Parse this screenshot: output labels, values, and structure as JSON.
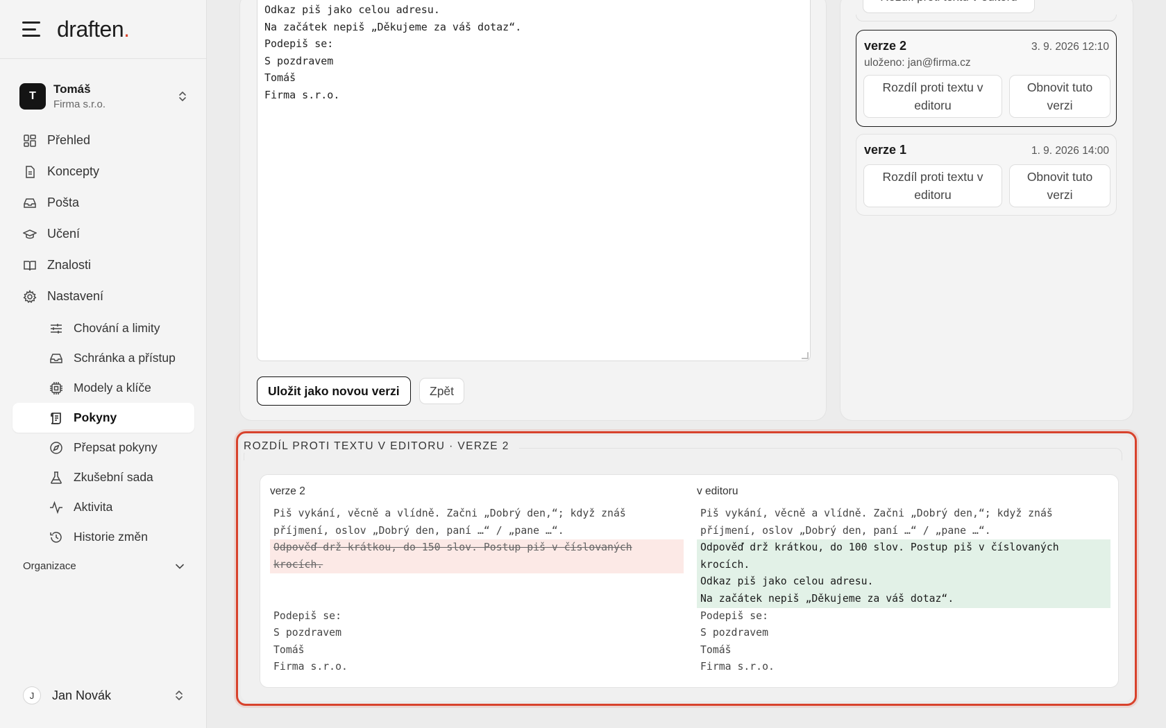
{
  "brand": {
    "logo_text": "draften",
    "logo_dot": ".",
    "accent": "#d9432b"
  },
  "account": {
    "initial": "T",
    "name": "Tomáš",
    "org": "Firma s.r.o."
  },
  "nav": [
    {
      "label": "Přehled",
      "icon": "dashboard-icon"
    },
    {
      "label": "Koncepty",
      "icon": "document-icon"
    },
    {
      "label": "Pošta",
      "icon": "inbox-icon"
    },
    {
      "label": "Učení",
      "icon": "graduation-cap-icon"
    },
    {
      "label": "Znalosti",
      "icon": "book-icon"
    },
    {
      "label": "Nastavení",
      "icon": "gear-icon"
    }
  ],
  "subnav": [
    {
      "label": "Chování a limity",
      "icon": "sliders-icon"
    },
    {
      "label": "Schránka a přístup",
      "icon": "inbox-icon"
    },
    {
      "label": "Modely a klíče",
      "icon": "chip-icon"
    },
    {
      "label": "Pokyny",
      "icon": "scroll-icon",
      "active": true
    },
    {
      "label": "Přepsat pokyny",
      "icon": "compass-icon"
    },
    {
      "label": "Zkušební sada",
      "icon": "flask-icon"
    },
    {
      "label": "Aktivita",
      "icon": "activity-icon"
    },
    {
      "label": "Historie změn",
      "icon": "history-icon"
    }
  ],
  "org_section": {
    "label": "Organizace"
  },
  "user": {
    "initial": "J",
    "name": "Jan Novák"
  },
  "editor": {
    "text": "Odkaz piš jako celou adresu.\nNa začátek nepiš „Děkujeme za váš dotaz“.\nPodepiš se:\nS pozdravem\nTomáš\nFirma s.r.o.",
    "save_label": "Uložit jako novou verzi",
    "back_label": "Zpět"
  },
  "versions": {
    "top_button_label": "Rozdíl proti textu v editoru",
    "items": [
      {
        "name": "verze 2",
        "date": "3. 9. 2026 12:10",
        "saved_by": "uloženo: jan@firma.cz",
        "diff_label": "Rozdíl proti textu v editoru",
        "restore_label": "Obnovit tuto verzi",
        "selected": true
      },
      {
        "name": "verze 1",
        "date": "1. 9. 2026 14:00",
        "diff_label": "Rozdíl proti textu v editoru",
        "restore_label": "Obnovit tuto verzi",
        "selected": false
      }
    ]
  },
  "diff": {
    "title": "ROZDÍL PROTI TEXTU V EDITORU · VERZE 2",
    "left_header": "verze 2",
    "right_header": "v editoru",
    "left_lines": [
      {
        "text": "Piš vykání, věcně a vlídně. Začni „Dobrý den,“; když znáš",
        "type": "same"
      },
      {
        "text": "příjmení, oslov „Dobrý den, paní …“ / „pane …“.",
        "type": "same"
      },
      {
        "text": "Odpověď drž krátkou, do 150 slov. Postup piš v číslovaných",
        "type": "del"
      },
      {
        "text": "krocích.",
        "type": "del"
      },
      {
        "text": "",
        "type": "blank"
      },
      {
        "text": "",
        "type": "blank"
      },
      {
        "text": "Podepiš se:",
        "type": "same"
      },
      {
        "text": "S pozdravem",
        "type": "same"
      },
      {
        "text": "Tomáš",
        "type": "same"
      },
      {
        "text": "Firma s.r.o.",
        "type": "same"
      }
    ],
    "right_lines": [
      {
        "text": "Piš vykání, věcně a vlídně. Začni „Dobrý den,“; když znáš",
        "type": "same"
      },
      {
        "text": "příjmení, oslov „Dobrý den, paní …“ / „pane …“.",
        "type": "same"
      },
      {
        "text": "Odpověď drž krátkou, do 100 slov. Postup piš v číslovaných",
        "type": "add"
      },
      {
        "text": "krocích.",
        "type": "add"
      },
      {
        "text": "Odkaz piš jako celou adresu.",
        "type": "add"
      },
      {
        "text": "Na začátek nepiš „Děkujeme za váš dotaz“.",
        "type": "add"
      },
      {
        "text": "Podepiš se:",
        "type": "same"
      },
      {
        "text": "S pozdravem",
        "type": "same"
      },
      {
        "text": "Tomáš",
        "type": "same"
      },
      {
        "text": "Firma s.r.o.",
        "type": "same"
      }
    ],
    "highlight_color": "#d8422c"
  }
}
